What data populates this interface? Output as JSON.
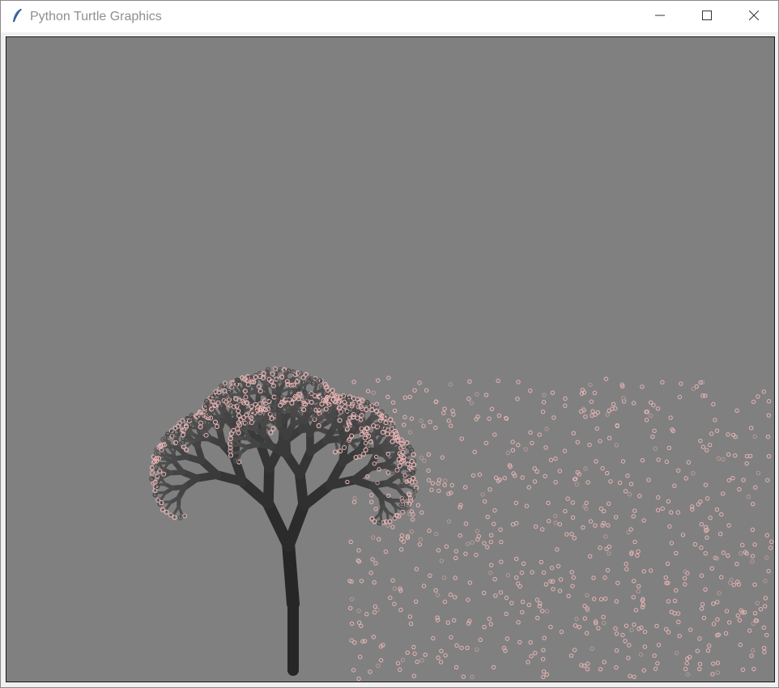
{
  "window": {
    "title": "Python Turtle Graphics",
    "icon": "feather-icon",
    "controls": [
      "minimize-icon",
      "maximize-icon",
      "close-icon"
    ]
  },
  "canvas": {
    "background": "#808080",
    "trunk_color": "#262626",
    "petal_color": "#e8b4b4"
  }
}
